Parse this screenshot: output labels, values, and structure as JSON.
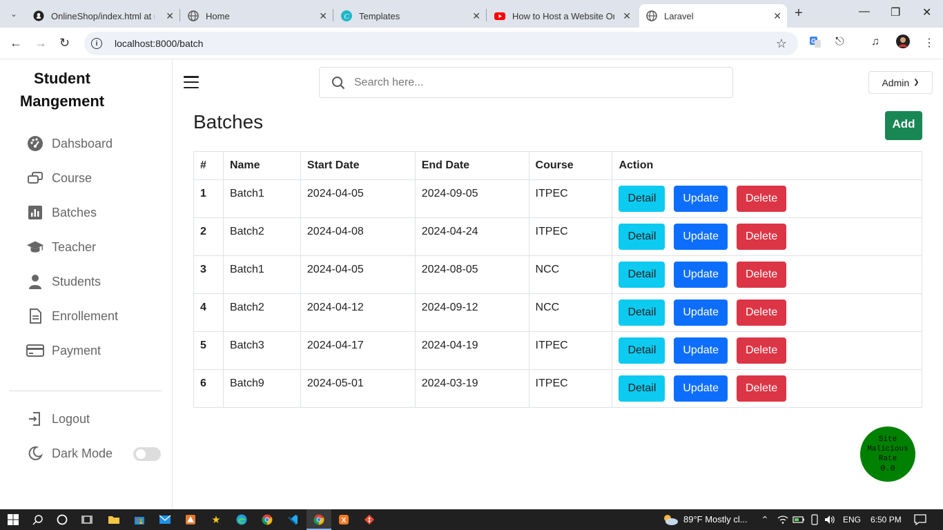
{
  "browser": {
    "tabs": [
      {
        "title": "OnlineShop/index.html at m",
        "icon": "github-icon"
      },
      {
        "title": "Home",
        "icon": "globe-icon"
      },
      {
        "title": "Templates",
        "icon": "canva-icon"
      },
      {
        "title": "How to Host a Website On C",
        "icon": "youtube-icon"
      },
      {
        "title": "Laravel",
        "icon": "globe-icon",
        "active": true
      }
    ],
    "url": "localhost:8000/batch"
  },
  "sidebar": {
    "brand_line1": "Student",
    "brand_line2": "Mangement",
    "items": [
      {
        "label": "Dahsboard",
        "icon": "dashboard-icon"
      },
      {
        "label": "Course",
        "icon": "course-icon"
      },
      {
        "label": "Batches",
        "icon": "chart-icon"
      },
      {
        "label": "Teacher",
        "icon": "graduation-cap-icon"
      },
      {
        "label": "Students",
        "icon": "user-icon"
      },
      {
        "label": "Enrollement",
        "icon": "document-icon"
      },
      {
        "label": "Payment",
        "icon": "credit-card-icon"
      }
    ],
    "logout": "Logout",
    "dark_mode": "Dark Mode",
    "dark_mode_on": false
  },
  "header": {
    "search_placeholder": "Search here...",
    "user_menu": "Admin"
  },
  "main": {
    "title": "Batches",
    "add_label": "Add",
    "columns": [
      "#",
      "Name",
      "Start Date",
      "End Date",
      "Course",
      "Action"
    ],
    "rows": [
      {
        "id": "1",
        "name": "Batch1",
        "start": "2024-04-05",
        "end": "2024-09-05",
        "course": "ITPEC"
      },
      {
        "id": "2",
        "name": "Batch2",
        "start": "2024-04-08",
        "end": "2024-04-24",
        "course": "ITPEC"
      },
      {
        "id": "3",
        "name": "Batch1",
        "start": "2024-04-05",
        "end": "2024-08-05",
        "course": "NCC"
      },
      {
        "id": "4",
        "name": "Batch2",
        "start": "2024-04-12",
        "end": "2024-09-12",
        "course": "NCC"
      },
      {
        "id": "5",
        "name": "Batch3",
        "start": "2024-04-17",
        "end": "2024-04-19",
        "course": "ITPEC"
      },
      {
        "id": "6",
        "name": "Batch9",
        "start": "2024-05-01",
        "end": "2024-03-19",
        "course": "ITPEC"
      }
    ],
    "actions": {
      "detail": "Detail",
      "update": "Update",
      "delete": "Delete"
    }
  },
  "malicious_badge": {
    "line1": "Site",
    "line2": "Malicious",
    "line3": "Rate",
    "value": "0.0"
  },
  "taskbar": {
    "weather": "89°F  Mostly cl...",
    "lang": "ENG",
    "time": "6:50 PM"
  },
  "colors": {
    "add": "#198754",
    "detail": "#0dcaf0",
    "update": "#0d6efd",
    "delete": "#dc3545",
    "badge": "#008000"
  }
}
